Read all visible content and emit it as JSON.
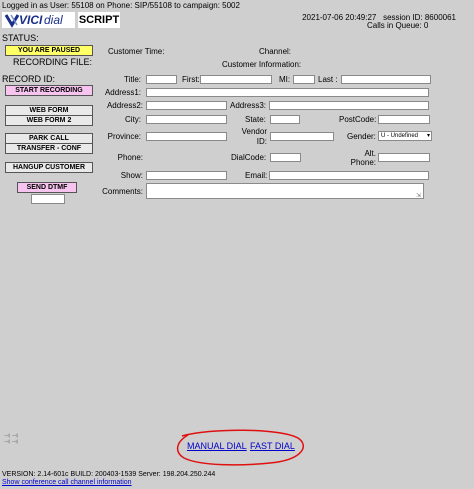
{
  "header": {
    "login_text": "Logged in as User: 55108 on Phone: SIP/55108  to campaign: 5002",
    "datetime": "2021-07-06 20:49:27",
    "session": "session ID: 8600061",
    "calls_in_queue": "Calls in Queue: 0",
    "logo_vici": "VICI",
    "logo_dial": "dial",
    "script_tab": "SCRIPT"
  },
  "left": {
    "status_label": "STATUS:",
    "paused_btn": "YOU ARE PAUSED",
    "recording_file": "RECORDING FILE:",
    "record_id": "RECORD ID:",
    "start_recording": "START RECORDING",
    "web_form": "WEB FORM",
    "web_form_2": "WEB FORM 2",
    "park_call": "PARK CALL",
    "transfer_conf": "TRANSFER - CONF",
    "hangup_customer": "HANGUP CUSTOMER",
    "send_dtmf": "SEND DTMF"
  },
  "form": {
    "customer_time": "Customer Time:",
    "channel": "Channel:",
    "customer_information": "Customer Information:",
    "title": "Title:",
    "first": "First:",
    "mi": "MI:",
    "last": "Last :",
    "address1": "Address1:",
    "address2": "Address2:",
    "address3": "Address3:",
    "city": "City:",
    "state": "State:",
    "postcode": "PostCode:",
    "province": "Province:",
    "vendor_id_1": "Vendor",
    "vendor_id_2": "ID:",
    "gender": "Gender:",
    "gender_value": "U - Undefined",
    "phone": "Phone:",
    "dialcode": "DialCode:",
    "alt_phone_1": "Alt.",
    "alt_phone_2": "Phone:",
    "show": "Show:",
    "email": "Email:",
    "comments": "Comments:"
  },
  "bottom": {
    "manual_dial": "MANUAL DIAL",
    "fast_dial": "FAST DIAL",
    "version": "VERSION: 2.14-601c   BUILD: 200403-1539   Server: 198.204.250.244",
    "conference_link": "Show conference call channel information"
  },
  "colors": {
    "background": "#cfcfcf",
    "paused_yellow": "#ffff66",
    "pink_button": "#f7c4ef",
    "annotation_red": "#e01010",
    "link_blue": "#0000cc"
  }
}
